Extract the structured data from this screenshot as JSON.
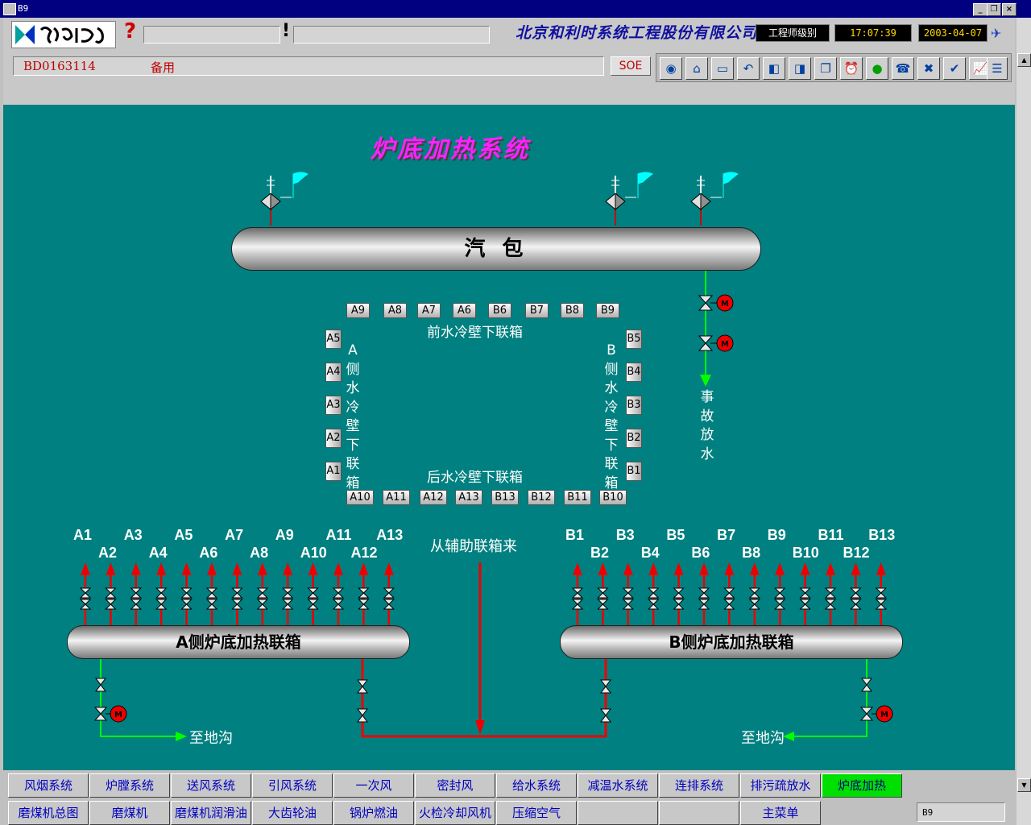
{
  "window": {
    "title": "B9"
  },
  "header": {
    "company": "北京和利时系统工程股份有限公司",
    "level": "工程师级别",
    "time": "17:07:39",
    "date": "2003-04-07",
    "tag_id": "BD0163114",
    "tag_desc": "备用",
    "soe_label": "SOE"
  },
  "page": {
    "title": "炉底加热系统",
    "drum_label": "汽  包",
    "front_header": "前水冷壁下联箱",
    "rear_header": "后水冷壁下联箱",
    "a_side_header": "A侧水冷壁下联箱",
    "b_side_header": "B侧水冷壁下联箱",
    "emergency_drain": "事故放水",
    "aux_source": "从辅助联箱来",
    "a_heating_header": "A侧炉底加热联箱",
    "b_heating_header": "B侧炉底加热联箱",
    "to_trench_left": "至地沟",
    "to_trench_right": "至地沟",
    "front_boxes": [
      "A9",
      "A8",
      "A7",
      "A6",
      "B6",
      "B7",
      "B8",
      "B9"
    ],
    "rear_boxes": [
      "A10",
      "A11",
      "A12",
      "A13",
      "B13",
      "B12",
      "B11",
      "B10"
    ],
    "left_boxes": [
      "A5",
      "A4",
      "A3",
      "A2",
      "A1"
    ],
    "right_boxes": [
      "B5",
      "B4",
      "B3",
      "B2",
      "B1"
    ],
    "a_branches_top": [
      "A1",
      "A3",
      "A5",
      "A7",
      "A9",
      "A11",
      "A13"
    ],
    "a_branches_bottom": [
      "A2",
      "A4",
      "A6",
      "A8",
      "A10",
      "A12"
    ],
    "b_branches_top": [
      "B1",
      "B3",
      "B5",
      "B7",
      "B9",
      "B11",
      "B13"
    ],
    "b_branches_bottom": [
      "B2",
      "B4",
      "B6",
      "B8",
      "B10",
      "B12"
    ]
  },
  "footer": {
    "row1": [
      "风烟系统",
      "炉膛系统",
      "送风系统",
      "引风系统",
      "一次风",
      "密封风",
      "给水系统",
      "减温水系统",
      "连排系统",
      "排污疏放水",
      "炉底加热"
    ],
    "row2": [
      "磨煤机总图",
      "磨煤机",
      "磨煤机润滑油",
      "大齿轮油",
      "锅炉燃油",
      "火检冷却风机",
      "压缩空气",
      "",
      "",
      "主菜单"
    ],
    "active": "炉底加热",
    "status": "B9"
  },
  "colors": {
    "background": "#008080",
    "steam_line": "#ff0000",
    "drain_line": "#00ff00",
    "title": "#ff20ff",
    "motor": "#ff0000"
  }
}
